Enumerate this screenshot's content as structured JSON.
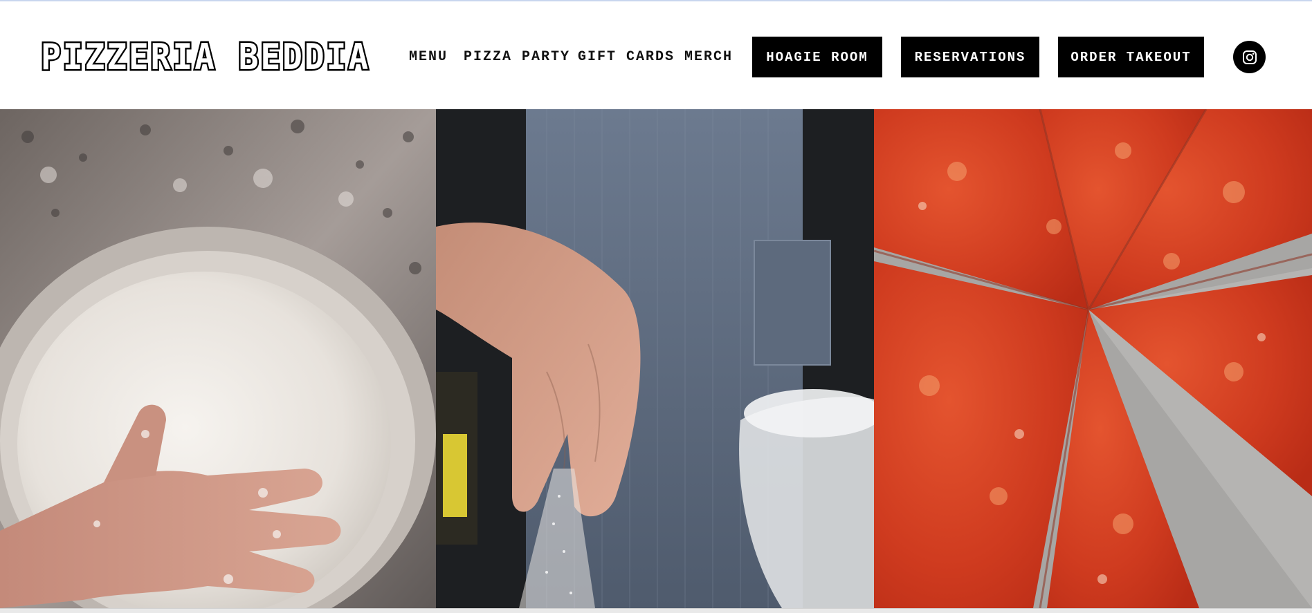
{
  "brand": {
    "logo_text": "PIZZERIA BEDDIA"
  },
  "nav": {
    "links": [
      {
        "label": "MENU"
      },
      {
        "label": "PIZZA PARTY"
      },
      {
        "label": "GIFT CARDS"
      },
      {
        "label": "MERCH"
      }
    ],
    "buttons": [
      {
        "label": "HOAGIE ROOM"
      },
      {
        "label": "RESERVATIONS"
      },
      {
        "label": "ORDER TAKEOUT"
      }
    ],
    "social_icon": "instagram-icon"
  },
  "gallery": {
    "photos": [
      {
        "subject": "dough-hand-photo"
      },
      {
        "subject": "flour-sprinkle-photo"
      },
      {
        "subject": "tomato-pie-photo"
      }
    ]
  },
  "colors": {
    "button_bg": "#000000",
    "button_text": "#ffffff",
    "nav_text": "#111111",
    "background": "#ffffff"
  }
}
